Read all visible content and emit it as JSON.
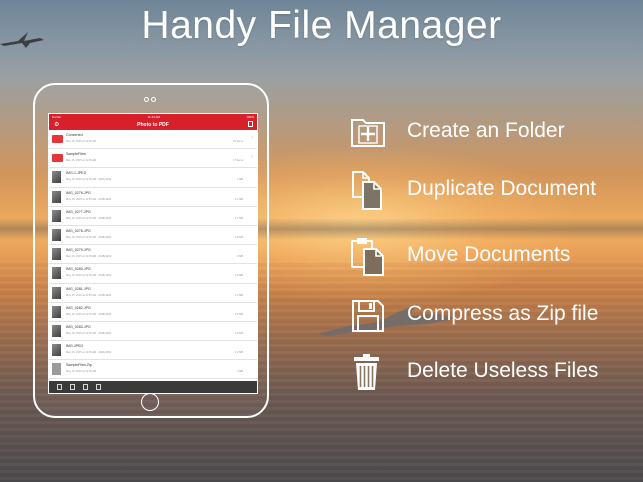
{
  "title": "Handy File Manager",
  "ipad": {
    "status": {
      "carrier": "Carrier",
      "time": "11:44 AM",
      "battery": "100%"
    },
    "nav_title": "Photo to PDF",
    "files": [
      {
        "name": "Converted",
        "meta": "May 15, 2015 at 11:35 AM",
        "size": "15 Items",
        "type": "folder"
      },
      {
        "name": "SampleFiles",
        "meta": "May 15, 2015 at 11:35 AM",
        "size": "17 Items",
        "type": "folder"
      },
      {
        "name": "IMG-1.JPEG",
        "meta": "May 15, 2015 at 11:35 AM · 3024x4032",
        "size": "1 MB",
        "type": "photo"
      },
      {
        "name": "IMG_0276.JPG",
        "meta": "May 15, 2015 at 11:35 AM · 2448x3264",
        "size": "2.1 MB",
        "type": "photo"
      },
      {
        "name": "IMG_0277.JPG",
        "meta": "May 15, 2015 at 11:35 AM · 2448x3264",
        "size": "1.7 MB",
        "type": "photo"
      },
      {
        "name": "IMG_0278.JPG",
        "meta": "May 15, 2015 at 11:35 AM · 2448x3264",
        "size": "1.8 MB",
        "type": "photo"
      },
      {
        "name": "IMG_0279.JPG",
        "meta": "May 15, 2015 at 11:35 AM · 2448x3264",
        "size": "2 MB",
        "type": "photo"
      },
      {
        "name": "IMG_0280.JPG",
        "meta": "May 15, 2015 at 11:35 AM · 2448x3264",
        "size": "1.9 MB",
        "type": "photo"
      },
      {
        "name": "IMG_0281.JPG",
        "meta": "May 15, 2015 at 11:35 AM · 2448x3264",
        "size": "2.2 MB",
        "type": "photo"
      },
      {
        "name": "IMG_0282.JPG",
        "meta": "May 15, 2015 at 11:35 AM · 2448x3264",
        "size": "1.6 MB",
        "type": "photo"
      },
      {
        "name": "IMG_0283.JPG",
        "meta": "May 15, 2015 at 11:35 AM · 2448x3264",
        "size": "1.5 MB",
        "type": "photo"
      },
      {
        "name": "IMG.JPEG",
        "meta": "May 15, 2015 at 11:35 AM · 3024x4032",
        "size": "1.2 MB",
        "type": "photo"
      },
      {
        "name": "SampleFiles.Zip",
        "meta": "May 15, 2015 at 11:35 AM",
        "size": "3 MB",
        "type": "zip"
      },
      {
        "name": "SampleFiles.zip",
        "meta": "May 15, 2015 at 11:35 AM",
        "size": "3 MB",
        "type": "doc"
      }
    ]
  },
  "features": [
    {
      "icon": "new-folder-icon",
      "label": "Create an Folder"
    },
    {
      "icon": "duplicate-document-icon",
      "label": "Duplicate Document"
    },
    {
      "icon": "move-documents-icon",
      "label": "Move Documents"
    },
    {
      "icon": "zip-file-icon",
      "label": "Compress as Zip file"
    },
    {
      "icon": "trash-icon",
      "label": "Delete Useless Files"
    }
  ],
  "colors": {
    "text": "#ffffff",
    "app_red": "#d8202a",
    "tab_bar": "#3a3a3a"
  }
}
